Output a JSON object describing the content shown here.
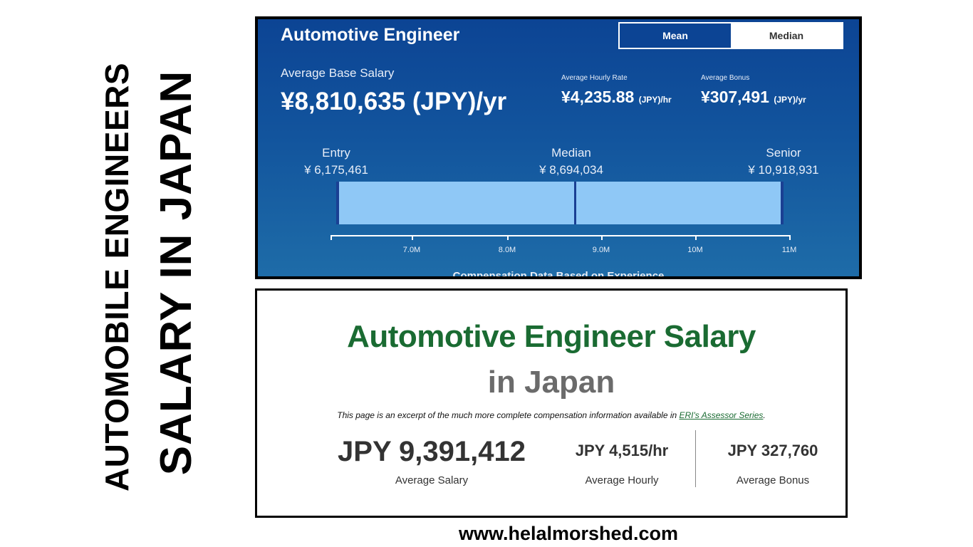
{
  "vertical": {
    "line1": "AUTOMOBILE ENGINEERS",
    "line2": "SALARY IN JAPAN"
  },
  "top_panel": {
    "title": "Automotive Engineer",
    "toggle": {
      "mean": "Mean",
      "median": "Median",
      "selected": "Mean"
    },
    "avg_base_label": "Average Base Salary",
    "avg_base_value": "¥8,810,635 (JPY)/yr",
    "hourly_label": "Average Hourly Rate",
    "hourly_value": "¥4,235.88",
    "hourly_unit": "(JPY)/hr",
    "bonus_label": "Average Bonus",
    "bonus_value": "¥307,491",
    "bonus_unit": "(JPY)/yr",
    "range": {
      "entry_label": "Entry",
      "entry_value": "¥ 6,175,461",
      "median_label": "Median",
      "median_value": "¥ 8,694,034",
      "senior_label": "Senior",
      "senior_value": "¥ 10,918,931"
    },
    "axis_ticks": [
      "7.0M",
      "8.0M",
      "9.0M",
      "10M",
      "11M"
    ],
    "caption": "Compensation Data Based on Experience"
  },
  "bottom_panel": {
    "title_line1": "Automotive Engineer Salary",
    "title_line2": "in Japan",
    "note_text": "This page is an excerpt of the much more complete compensation information available in ",
    "note_link": "ERI's Assessor Series",
    "note_end": ".",
    "salary_value": "JPY 9,391,412",
    "salary_label": "Average Salary",
    "hourly_value": "JPY 4,515/hr",
    "hourly_label": "Average Hourly",
    "bonus_value": "JPY 327,760",
    "bonus_label": "Average Bonus"
  },
  "footer": "www.helalmorshed.com",
  "colors": {
    "panel_blue": "#0c4494",
    "bar_fill": "#8fc8f6",
    "title_green": "#1a6b32",
    "title_gray": "#6b6b6b"
  }
}
